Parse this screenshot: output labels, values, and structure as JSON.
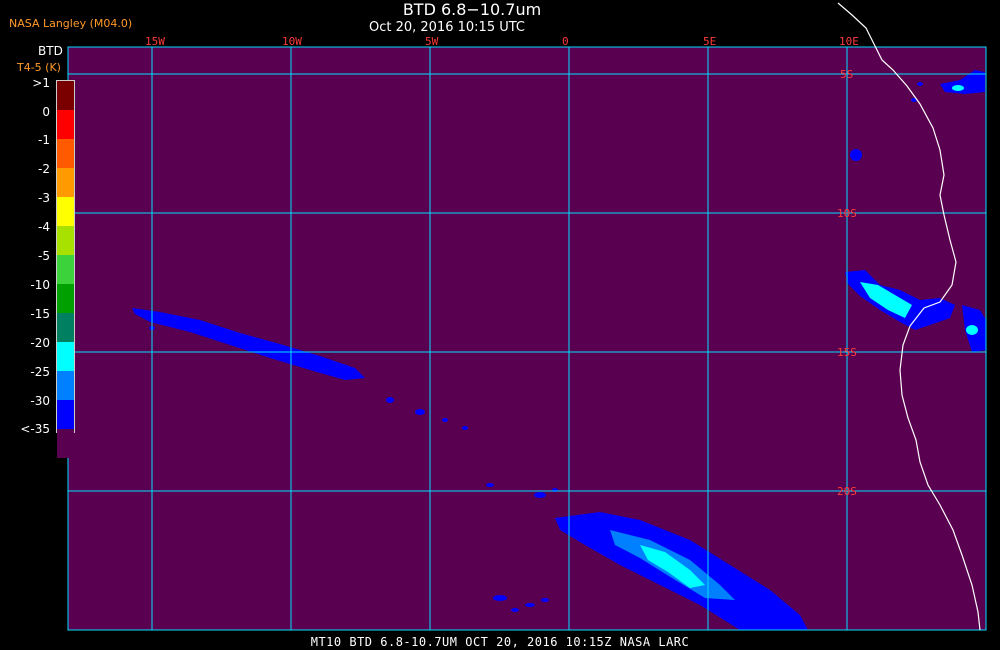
{
  "header": {
    "title": "BTD 6.8−10.7um",
    "datetime": "Oct 20, 2016 10:15 UTC",
    "org": "NASA Langley (M04.0)"
  },
  "legend": {
    "title": "BTD",
    "units": "T4-5 (K)",
    "ticks": [
      ">1",
      "0",
      "-1",
      "-2",
      "-3",
      "-4",
      "-5",
      "-10",
      "-15",
      "-20",
      "-25",
      "-30",
      "<-35"
    ],
    "colors": [
      "#7a0000",
      "#ff0000",
      "#ff5a00",
      "#ff9a00",
      "#ffff00",
      "#a8e000",
      "#3cd23c",
      "#00a000",
      "#008060",
      "#00ffff",
      "#0080ff",
      "#0000ff",
      "#5a0050"
    ]
  },
  "map": {
    "background_color": "#5a0050",
    "grid_color": "#00e0ff",
    "coast_color": "#ffffff",
    "lon_labels": [
      "15W",
      "10W",
      "5W",
      "0",
      "5E",
      "10E"
    ],
    "lat_labels": [
      "5S",
      "10S",
      "15S",
      "20S"
    ]
  },
  "footer": {
    "text": "MT10  BTD 6.8-10.7UM   OCT 20, 2016 10:15Z   NASA LARC"
  }
}
